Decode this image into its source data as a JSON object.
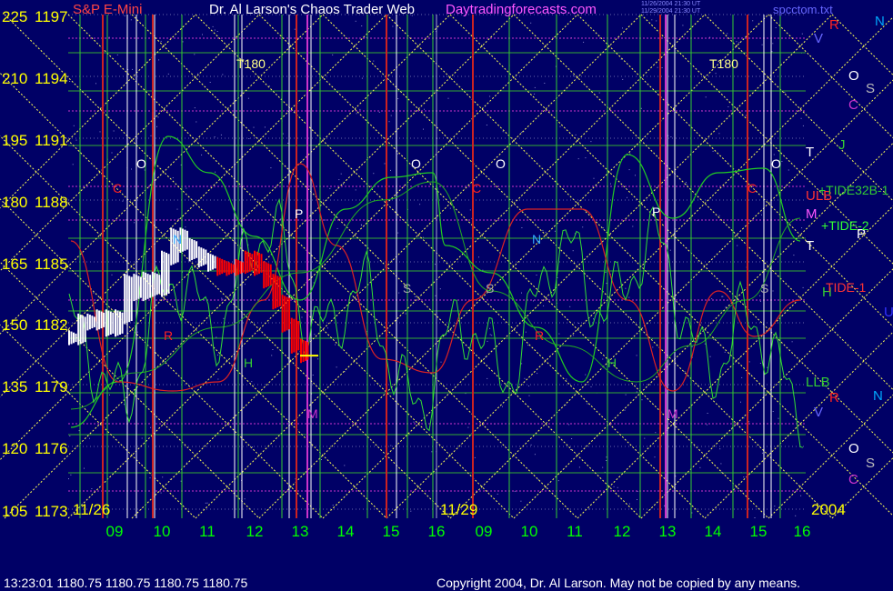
{
  "header": {
    "instrument": "S&P E-Mini",
    "title": "Dr. Al Larson's Chaos Trader Web",
    "site": "Daytradingforecasts.com",
    "timestamp_lines": [
      "11/26/2004 21:30 UT",
      "11/29/2004 21:30 UT"
    ],
    "file": "spcctom.txt"
  },
  "footer": {
    "quote": "13:23:01  1180.75 1180.75 1180.75 1180.75",
    "copyright": "Copyright 2004, Dr. Al Larson. May not be copied by any means."
  },
  "colors": {
    "background": "#000066",
    "price_axis_text": "#ffff00",
    "hour_text": "#00ff00",
    "green_line": "#00dd00",
    "red_line": "#dd0000",
    "yellow_diag": "#ffff55",
    "magenta_hline": "#cc33cc",
    "price_bars": "#ffffff",
    "price_bars_late": "#ff0000"
  },
  "chart_data": {
    "type": "line",
    "title": "Dr. Al Larson's Chaos Trader Web",
    "y_left_labels": [
      "225",
      "210",
      "195",
      "180",
      "165",
      "150",
      "135",
      "120",
      "105"
    ],
    "y_right_labels": [
      "1197",
      "1194",
      "1191",
      "1188",
      "1185",
      "1182",
      "1179",
      "1176",
      "1173"
    ],
    "ylim_price": [
      1173,
      1197
    ],
    "ylim_tide": [
      105,
      225
    ],
    "date_labels": [
      "11/26",
      "11/29",
      "2004"
    ],
    "x_hours": [
      "09",
      "10",
      "11",
      "12",
      "13",
      "14",
      "15",
      "16",
      "09",
      "10",
      "11",
      "12",
      "13",
      "14",
      "15",
      "16"
    ],
    "price_series": {
      "name": "S&P E-Mini",
      "x_hour_index": [
        0.0,
        0.2,
        0.4,
        0.6,
        0.8,
        1.0,
        1.2,
        1.4,
        1.6,
        1.8,
        2.0,
        2.2,
        2.4,
        2.6,
        2.8,
        3.0,
        3.2,
        3.4,
        3.6,
        3.8,
        4.0,
        4.2,
        4.4,
        4.6,
        4.8,
        5.0
      ],
      "close": [
        1181.6,
        1182.4,
        1182.3,
        1182.6,
        1182.0,
        1182.6,
        1184.3,
        1183.7,
        1184.4,
        1183.9,
        1185.4,
        1186.5,
        1186.0,
        1185.6,
        1185.3,
        1185.1,
        1184.9,
        1184.9,
        1185.0,
        1185.4,
        1184.9,
        1184.3,
        1183.3,
        1182.2,
        1181.2,
        1180.75
      ]
    },
    "annotations": {
      "tide_labels": [
        "+TIDE32B-1",
        "+TIDE-2",
        "TIDE-1"
      ],
      "right_letters": [
        "V",
        "R",
        "N",
        "O",
        "S",
        "C",
        "J",
        "T",
        "ULB",
        "M",
        "P",
        "T",
        "H",
        "U",
        "LLB",
        "R",
        "N",
        "V",
        "O",
        "S",
        "C"
      ],
      "in_chart_letters": [
        "T180",
        "T180",
        "O",
        "O",
        "O",
        "O",
        "C",
        "C",
        "C",
        "N",
        "N",
        "P",
        "P",
        "S",
        "S",
        "S",
        "H",
        "H",
        "R",
        "R",
        "M",
        "M"
      ]
    }
  }
}
